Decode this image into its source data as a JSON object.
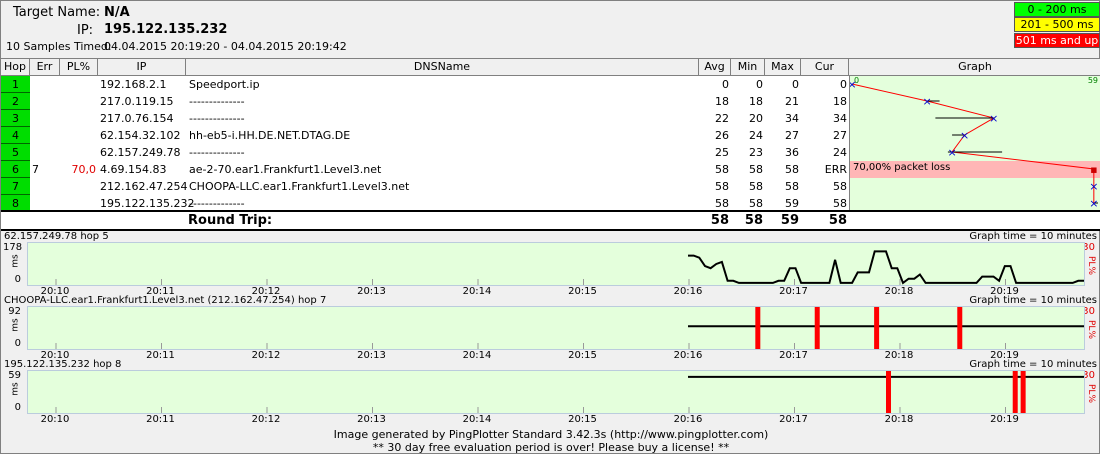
{
  "header": {
    "target_label": "Target Name:",
    "target_value": "N/A",
    "ip_label": "IP:",
    "ip_value": "195.122.135.232",
    "samples_label": "10 Samples Timed:",
    "samples_range": "04.04.2015 20:19:20 - 04.04.2015 20:19:42"
  },
  "legend": [
    {
      "label": "0 - 200 ms",
      "color": "#00ff00"
    },
    {
      "label": "201 - 500 ms",
      "color": "#ffff00"
    },
    {
      "label": "501 ms and up",
      "color": "#ff0000"
    }
  ],
  "table": {
    "columns": [
      "Hop",
      "Err",
      "PL%",
      "IP",
      "DNSName",
      "Avg",
      "Min",
      "Max",
      "Cur",
      "Graph"
    ],
    "graph_scale_min": "0",
    "graph_scale_max": "59",
    "rows": [
      {
        "hop": "1",
        "err": "",
        "pl": "",
        "ip": "192.168.2.1",
        "dns": "Speedport.ip",
        "avg": "0",
        "min": "0",
        "max": "0",
        "cur": "0"
      },
      {
        "hop": "2",
        "err": "",
        "pl": "",
        "ip": "217.0.119.15",
        "dns": "--------------",
        "avg": "18",
        "min": "18",
        "max": "21",
        "cur": "18"
      },
      {
        "hop": "3",
        "err": "",
        "pl": "",
        "ip": "217.0.76.154",
        "dns": "--------------",
        "avg": "22",
        "min": "20",
        "max": "34",
        "cur": "34"
      },
      {
        "hop": "4",
        "err": "",
        "pl": "",
        "ip": "62.154.32.102",
        "dns": "hh-eb5-i.HH.DE.NET.DTAG.DE",
        "avg": "26",
        "min": "24",
        "max": "27",
        "cur": "27"
      },
      {
        "hop": "5",
        "err": "",
        "pl": "",
        "ip": "62.157.249.78",
        "dns": "--------------",
        "avg": "25",
        "min": "23",
        "max": "36",
        "cur": "24"
      },
      {
        "hop": "6",
        "err": "7",
        "pl": "70,0",
        "ip": "4.69.154.83",
        "dns": "ae-2-70.ear1.Frankfurt1.Level3.net",
        "avg": "58",
        "min": "58",
        "max": "58",
        "cur": "ERR"
      },
      {
        "hop": "7",
        "err": "",
        "pl": "",
        "ip": "212.162.47.254",
        "dns": "CHOOPA-LLC.ear1.Frankfurt1.Level3.net",
        "avg": "58",
        "min": "58",
        "max": "58",
        "cur": "58"
      },
      {
        "hop": "8",
        "err": "",
        "pl": "",
        "ip": "195.122.135.232",
        "dns": "--------------",
        "avg": "58",
        "min": "58",
        "max": "59",
        "cur": "58"
      }
    ],
    "packet_loss_note": "70,00% packet loss",
    "round_trip": {
      "label": "Round Trip:",
      "avg": "58",
      "min": "58",
      "max": "59",
      "cur": "58"
    }
  },
  "timelines": [
    {
      "title": "62.157.249.78 hop 5",
      "graph_time": "Graph time = 10 minutes",
      "ymax": "178",
      "ymid": "",
      "ymin": "0",
      "pl_top": "30",
      "unit_ms": "ms",
      "unit_pl": "PL%"
    },
    {
      "title": "CHOOPA-LLC.ear1.Frankfurt1.Level3.net (212.162.47.254) hop 7",
      "graph_time": "Graph time = 10 minutes",
      "ymax": "92",
      "ymid": "",
      "ymin": "0",
      "pl_top": "30",
      "unit_ms": "ms",
      "unit_pl": "PL%"
    },
    {
      "title": "195.122.135.232 hop 8",
      "graph_time": "Graph time = 10 minutes",
      "ymax": "59",
      "ymid": "",
      "ymin": "0",
      "pl_top": "30",
      "unit_ms": "ms",
      "unit_pl": "PL%"
    }
  ],
  "time_ticks": [
    "20:10",
    "20:11",
    "20:12",
    "20:13",
    "20:14",
    "20:15",
    "20:16",
    "20:17",
    "20:18",
    "20:19"
  ],
  "footer": {
    "line1": "Image generated by PingPlotter Standard 3.42.3s (http://www.pingplotter.com)",
    "line2": "** 30 day free evaluation period is over!  Please buy a license! **"
  },
  "colors": {
    "graph_bg": "#e4ffdc",
    "hop_green": "#00dd00",
    "loss_red": "#ff0000",
    "loss_row": "#ffb6b6"
  }
}
